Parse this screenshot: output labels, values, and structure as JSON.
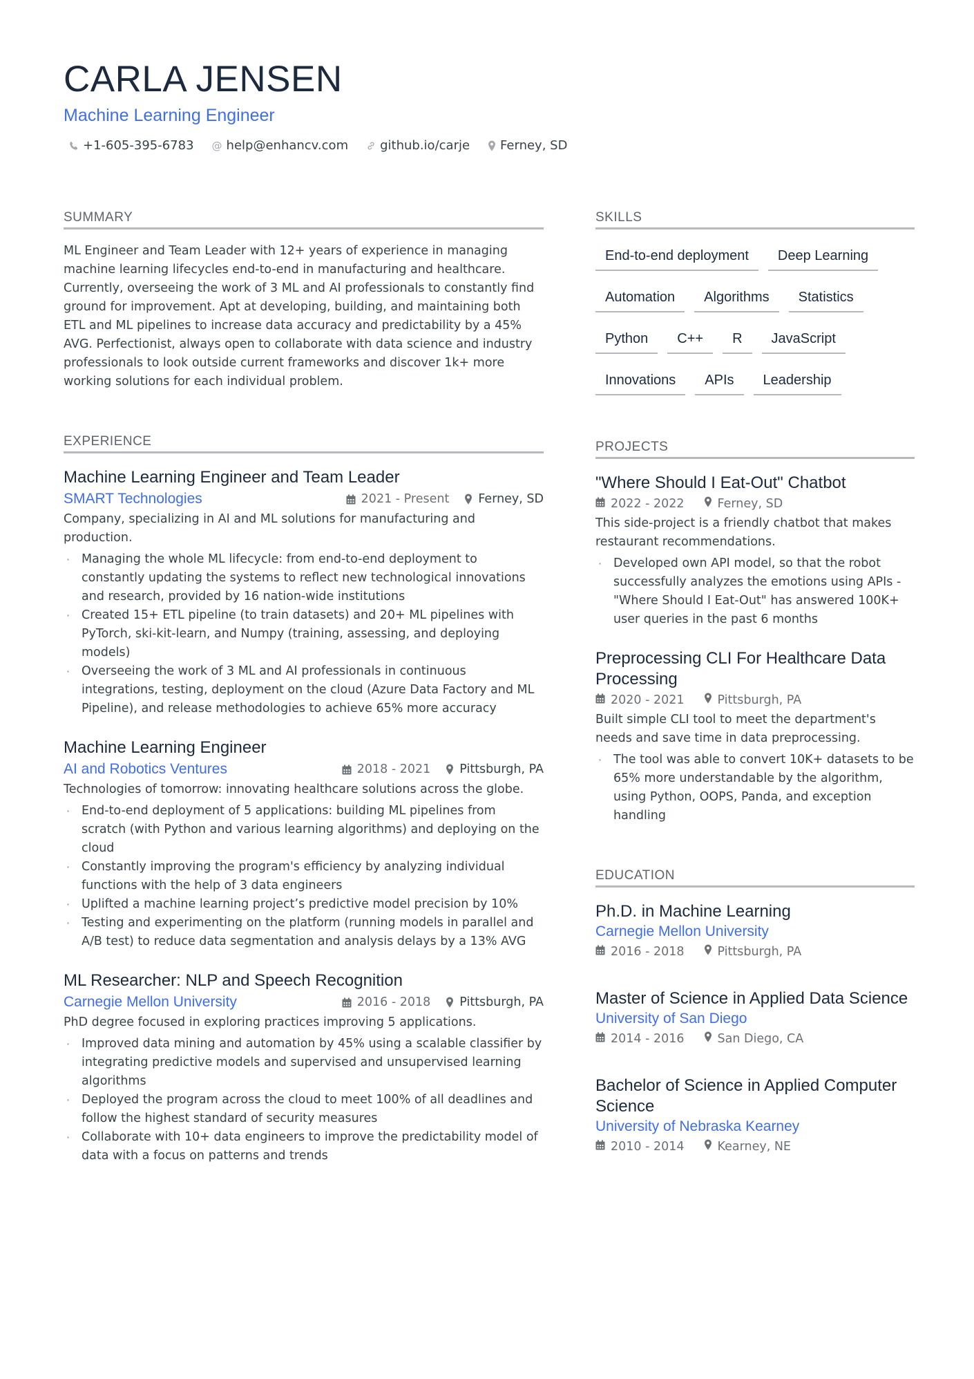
{
  "header": {
    "name": "CARLA JENSEN",
    "title": "Machine Learning Engineer",
    "contacts": [
      {
        "icon": "phone-icon",
        "text": "+1-605-395-6783"
      },
      {
        "icon": "at-icon",
        "text": "help@enhancv.com"
      },
      {
        "icon": "link-icon",
        "text": "github.io/carje"
      },
      {
        "icon": "location-icon",
        "text": "Ferney, SD"
      }
    ]
  },
  "summary": {
    "heading": "SUMMARY",
    "text": "ML Engineer and Team Leader with 12+ years of experience in managing machine learning lifecycles end-to-end in manufacturing and healthcare. Currently, overseeing the work of 3 ML and AI professionals to constantly find ground for improvement. Apt at developing, building, and maintaining both ETL and ML pipelines to increase data accuracy and predictability by a 45% AVG. Perfectionist, always open to collaborate with data science and industry professionals to look outside current frameworks and discover 1k+ more working solutions for each individual problem."
  },
  "experience": {
    "heading": "EXPERIENCE",
    "items": [
      {
        "title": "Machine Learning Engineer and Team Leader",
        "company": "SMART Technologies",
        "dates": "2021 - Present",
        "location": "Ferney, SD",
        "description": "Company, specializing in AI and ML solutions for manufacturing and production.",
        "bullets": [
          "Managing the whole ML lifecycle: from end-to-end deployment to constantly updating the systems to reflect new technological innovations and research, provided by 16 nation-wide institutions",
          "Created 15+ ETL pipeline (to train datasets) and 20+ ML pipelines with PyTorch, ski-kit-learn, and Numpy (training, assessing, and deploying models)",
          "Overseeing the work of 3 ML and AI professionals in continuous integrations, testing, deployment on the cloud (Azure Data Factory and ML Pipeline), and release methodologies to achieve 65% more accuracy"
        ]
      },
      {
        "title": "Machine Learning Engineer",
        "company": "AI and Robotics Ventures",
        "dates": "2018 - 2021",
        "location": "Pittsburgh, PA",
        "description": "Technologies of tomorrow: innovating healthcare solutions across the globe.",
        "bullets": [
          "End-to-end deployment of 5 applications: building ML pipelines from scratch (with Python and various learning algorithms) and deploying on the cloud",
          "Constantly improving the program's efficiency by analyzing individual functions with the help of 3 data engineers",
          "Uplifted a machine learning project’s predictive model precision by 10%",
          "Testing and experimenting on the platform (running models in parallel and A/B test) to reduce data segmentation and analysis delays by a 13% AVG"
        ]
      },
      {
        "title": "ML Researcher: NLP and Speech Recognition",
        "company": "Carnegie Mellon University",
        "dates": "2016 - 2018",
        "location": "Pittsburgh, PA",
        "description": "PhD degree focused in exploring practices improving 5 applications.",
        "bullets": [
          "Improved data mining and automation by 45% using a scalable classifier by integrating predictive models and supervised and unsupervised learning algorithms",
          "Deployed the program across the cloud to meet 100% of all deadlines and follow the highest standard of security measures",
          "Collaborate with 10+ data engineers to improve the predictability model of data with a focus on patterns and trends"
        ]
      }
    ]
  },
  "skills": {
    "heading": "SKILLS",
    "items": [
      "End-to-end deployment",
      "Deep Learning",
      "Automation",
      "Algorithms",
      "Statistics",
      "Python",
      "C++",
      "R",
      "JavaScript",
      "Innovations",
      "APIs",
      "Leadership"
    ]
  },
  "projects": {
    "heading": "PROJECTS",
    "items": [
      {
        "title": "\"Where Should I Eat-Out\" Chatbot",
        "dates": "2022 - 2022",
        "location": "Ferney, SD",
        "description": "This side-project is a friendly chatbot that makes restaurant recommendations.",
        "bullets": [
          "Developed own API model, so that the robot successfully analyzes the emotions using APIs - \"Where Should I Eat-Out\" has answered 100K+ user queries in the past 6 months"
        ]
      },
      {
        "title": "Preprocessing CLI For Healthcare Data Processing",
        "dates": "2020 - 2021",
        "location": "Pittsburgh, PA",
        "description": "Built simple CLI tool to meet the department's needs and save time in data preprocessing.",
        "bullets": [
          "The tool was able to convert 10K+ datasets to be 65% more understandable by the algorithm, using Python, OOPS, Panda, and exception handling"
        ]
      }
    ]
  },
  "education": {
    "heading": "EDUCATION",
    "items": [
      {
        "degree": "Ph.D. in Machine Learning",
        "school": "Carnegie Mellon University",
        "dates": "2016 - 2018",
        "location": "Pittsburgh, PA"
      },
      {
        "degree": "Master of Science in Applied Data Science",
        "school": "University of San Diego",
        "dates": "2014 - 2016",
        "location": "San Diego, CA"
      },
      {
        "degree": "Bachelor of Science in Applied Computer Science",
        "school": "University of Nebraska Kearney",
        "dates": "2010 - 2014",
        "location": "Kearney, NE"
      }
    ]
  },
  "colors": {
    "accent": "#3f6ee8",
    "heading": "#1c2a3f",
    "body": "#384347",
    "muted": "#6b7075",
    "rule": "#b7b9bc"
  }
}
